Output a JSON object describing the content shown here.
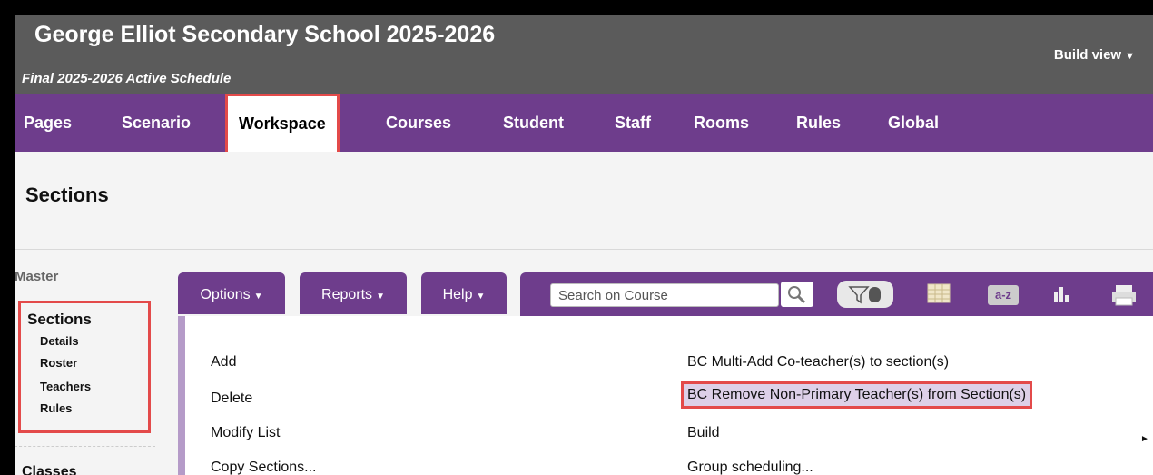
{
  "header": {
    "school_title": "George Elliot Secondary School 2025-2026",
    "schedule_subtitle": "Final 2025-2026 Active Schedule",
    "build_view_label": "Build view"
  },
  "nav": {
    "items": [
      {
        "label": "Pages"
      },
      {
        "label": "Scenario"
      },
      {
        "label": "Workspace",
        "active": true
      },
      {
        "label": "Courses"
      },
      {
        "label": "Student"
      },
      {
        "label": "Staff"
      },
      {
        "label": "Rooms"
      },
      {
        "label": "Rules"
      },
      {
        "label": "Global"
      }
    ]
  },
  "page": {
    "title": "Sections"
  },
  "sidebar": {
    "master_label": "Master",
    "group_title": "Sections",
    "items": [
      {
        "label": "Details"
      },
      {
        "label": "Roster"
      },
      {
        "label": "Teachers"
      },
      {
        "label": "Rules"
      }
    ],
    "next_group": "Classes"
  },
  "toolbar": {
    "options_label": "Options",
    "reports_label": "Reports",
    "help_label": "Help",
    "search_placeholder": "Search on Course",
    "az_label": "a-z"
  },
  "menu": {
    "left": [
      {
        "label": "Add"
      },
      {
        "label": "Delete"
      },
      {
        "label": "Modify List"
      },
      {
        "label": "Copy Sections..."
      }
    ],
    "right": [
      {
        "label": "BC Multi-Add Co-teacher(s) to section(s)"
      },
      {
        "label": "BC Remove Non-Primary Teacher(s) from Section(s)",
        "highlighted": true
      },
      {
        "label": "Build",
        "has_submenu": true
      },
      {
        "label": "Group scheduling..."
      }
    ]
  },
  "colors": {
    "header_bg": "#5b5b5b",
    "nav_bg": "#6e3d8c",
    "highlight_border": "#e34a4a",
    "menu_highlight_bg": "#ddd0e8"
  }
}
